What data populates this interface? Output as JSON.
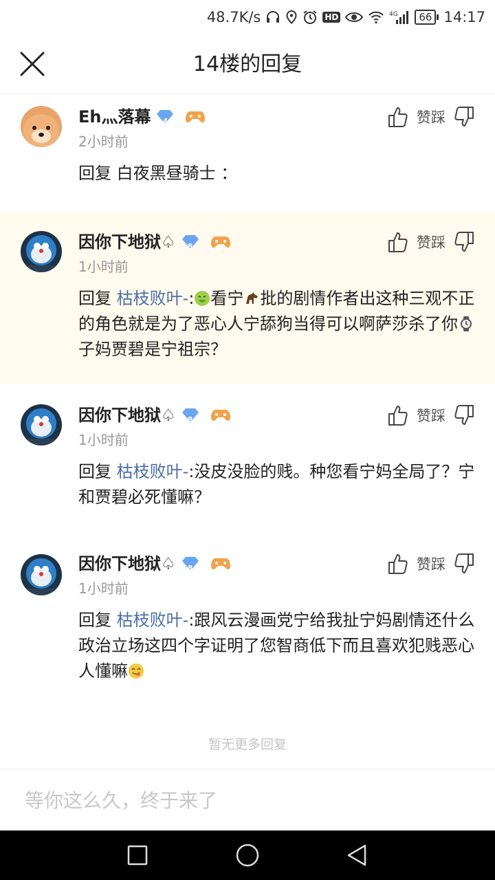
{
  "status_bar": {
    "speed": "48.7K/s",
    "hd": "HD",
    "network": "4G",
    "battery": "66",
    "time": "14:17"
  },
  "header": {
    "title": "14楼的回复"
  },
  "replies": [
    {
      "username": "Eh灬落幕",
      "level": "4",
      "time": "2小时前",
      "vote_label": "赞踩",
      "prefix": "回复 白夜黑昼骑士 ：",
      "target": "",
      "text_parts": [],
      "highlighted": false
    },
    {
      "username": "因你下地狱♤",
      "level": "8",
      "time": "1小时前",
      "vote_label": "赞踩",
      "prefix": "回复 ",
      "target": "枯枝败叶-",
      "text_parts": [
        ":",
        "看宁",
        "批的剧情作者出这种三观不正的角色就是为了恶心人宁舔狗当得可以啊萨莎杀了你",
        "子妈贾碧是宁祖宗？"
      ],
      "highlighted": true
    },
    {
      "username": "因你下地狱♤",
      "level": "8",
      "time": "1小时前",
      "vote_label": "赞踩",
      "prefix": "回复 ",
      "target": "枯枝败叶-",
      "text_parts": [
        ":没皮没脸的贱。种您看宁妈全局了？宁和贾碧必死懂嘛？"
      ],
      "highlighted": false
    },
    {
      "username": "因你下地狱♤",
      "level": "8",
      "time": "1小时前",
      "vote_label": "赞踩",
      "prefix": "回复 ",
      "target": "枯枝败叶-",
      "text_parts": [
        ":跟风云漫画党宁给我扯宁妈剧情还什么政治立场这四个字证明了您智商低下而且喜欢犯贱恶心人懂嘛"
      ],
      "highlighted": false
    }
  ],
  "footer": {
    "no_more": "暂无更多回复",
    "input_placeholder": "等你这么久，终于来了"
  },
  "icons": {
    "back": "close-icon",
    "like": "thumb-up-icon",
    "dislike": "thumb-down-icon",
    "level_badge": "diamond-icon",
    "game_badge": "gamepad-icon"
  },
  "colors": {
    "link": "#4a6ea8",
    "highlight_bg": "#fffbee",
    "level_badge": "#6aa6f0",
    "game_badge": "#f3a24a"
  }
}
